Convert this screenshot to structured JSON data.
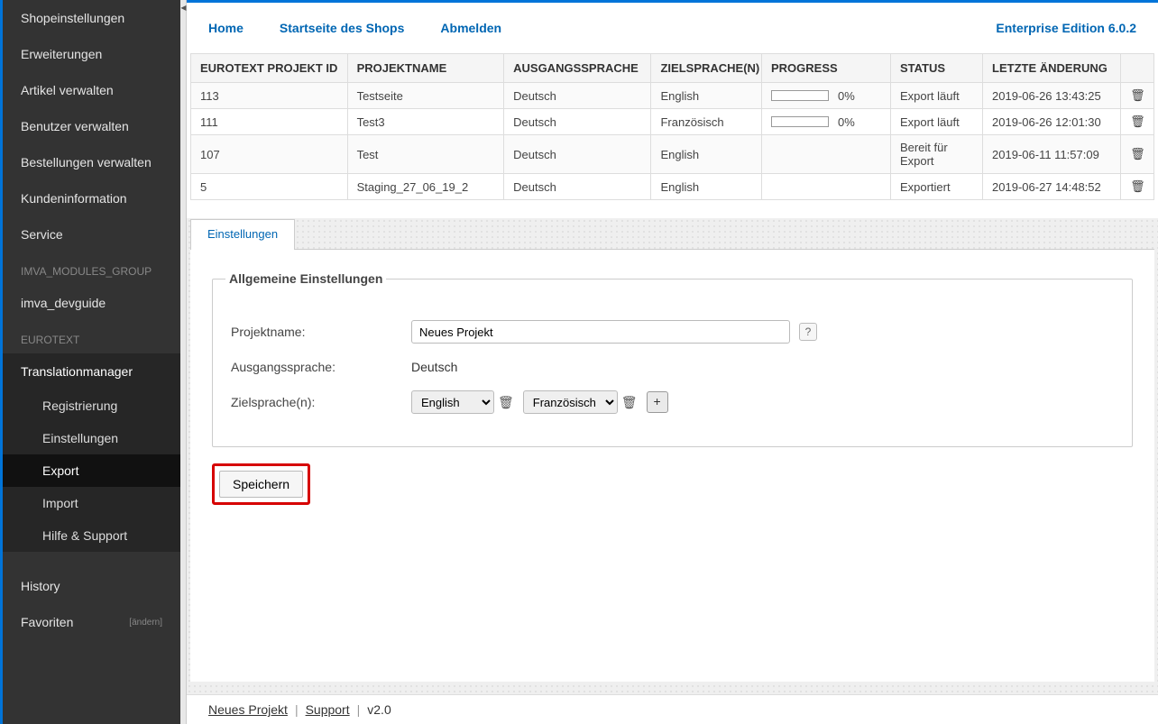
{
  "sidebar": {
    "items": [
      "Shopeinstellungen",
      "Erweiterungen",
      "Artikel verwalten",
      "Benutzer verwalten",
      "Bestellungen verwalten",
      "Kundeninformation",
      "Service"
    ],
    "group1_label": "IMVA_MODULES_GROUP",
    "group1_item": "imva_devguide",
    "group2_label": "EUROTEXT",
    "tm_label": "Translationmanager",
    "tm_sub": [
      "Registrierung",
      "Einstellungen",
      "Export",
      "Import",
      "Hilfe & Support"
    ],
    "history": "History",
    "favoriten": "Favoriten",
    "favoriten_action": "[ändern]"
  },
  "topnav": {
    "home": "Home",
    "startseite": "Startseite des Shops",
    "abmelden": "Abmelden",
    "edition": "Enterprise Edition 6.0.2"
  },
  "table": {
    "headers": {
      "id": "EUROTEXT PROJEKT ID",
      "name": "PROJEKTNAME",
      "src": "AUSGANGSSPRACHE",
      "tgt": "ZIELSPRACHE(N)",
      "progress": "PROGRESS",
      "status": "STATUS",
      "changed": "LETZTE ÄNDERUNG"
    },
    "rows": [
      {
        "id": "113",
        "name": "Testseite",
        "src": "Deutsch",
        "tgt": "English",
        "progress": "0%",
        "status": "Export läuft",
        "changed": "2019-06-26 13:43:25",
        "show_bar": true
      },
      {
        "id": "111",
        "name": "Test3",
        "src": "Deutsch",
        "tgt": "Französisch",
        "progress": "0%",
        "status": "Export läuft",
        "changed": "2019-06-26 12:01:30",
        "show_bar": true
      },
      {
        "id": "107",
        "name": "Test",
        "src": "Deutsch",
        "tgt": "English",
        "progress": "",
        "status": "Bereit für Export",
        "changed": "2019-06-11 11:57:09",
        "show_bar": false
      },
      {
        "id": "5",
        "name": "Staging_27_06_19_2",
        "src": "Deutsch",
        "tgt": "English",
        "progress": "",
        "status": "Exportiert",
        "changed": "2019-06-27 14:48:52",
        "show_bar": false
      }
    ]
  },
  "tab": {
    "einstellungen": "Einstellungen"
  },
  "form": {
    "legend": "Allgemeine Einstellungen",
    "projektname_label": "Projektname:",
    "projektname_value": "Neues Projekt",
    "help": "?",
    "src_label": "Ausgangssprache:",
    "src_value": "Deutsch",
    "tgt_label": "Zielsprache(n):",
    "tgt_values": [
      "English",
      "Französisch"
    ],
    "add": "+",
    "save": "Speichern"
  },
  "footer": {
    "project": "Neues Projekt",
    "support": "Support",
    "version": "v2.0"
  }
}
